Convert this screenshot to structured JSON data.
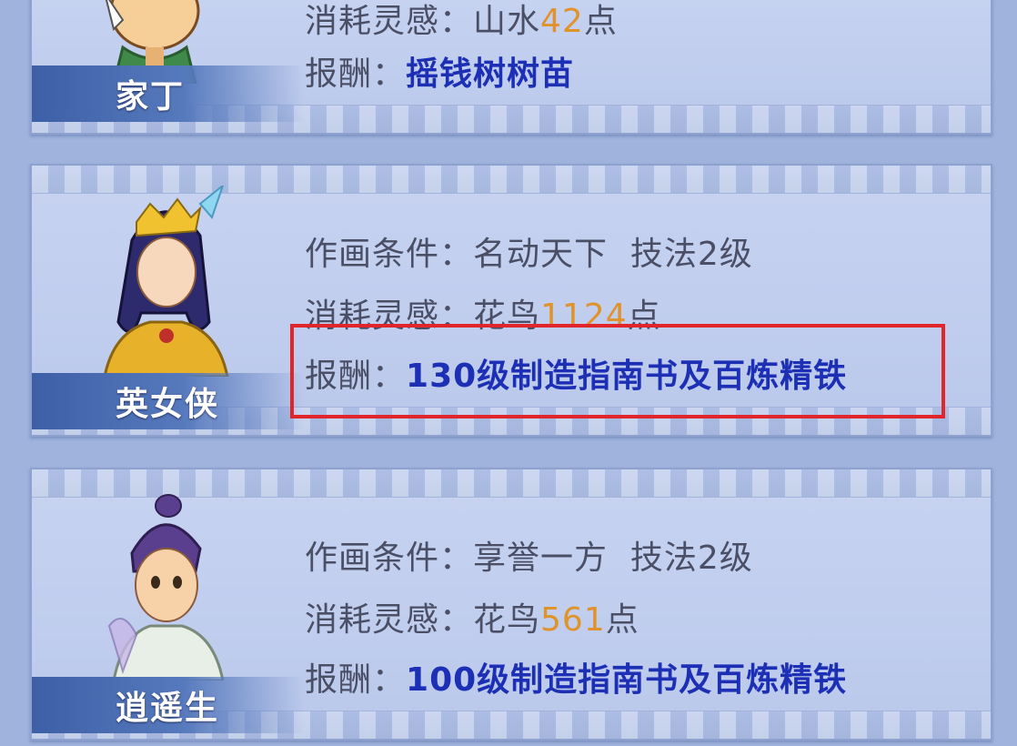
{
  "cards": [
    {
      "name": "家丁",
      "cost_label": "消耗灵感：",
      "cost_type": "山水",
      "cost_value": "42",
      "cost_unit": "点",
      "reward_label": "报酬：",
      "reward": "摇钱树树苗"
    },
    {
      "name": "英女侠",
      "cond_label": "作画条件：",
      "cond_value": "名动天下  技法2级",
      "cost_label": "消耗灵感：",
      "cost_type": "花鸟",
      "cost_value": "1124",
      "cost_unit": "点",
      "reward_label": "报酬：",
      "reward": "130级制造指南书及百炼精铁"
    },
    {
      "name": "逍遥生",
      "cond_label": "作画条件：",
      "cond_value": "享誉一方  技法2级",
      "cost_label": "消耗灵感：",
      "cost_type": "花鸟",
      "cost_value": "561",
      "cost_unit": "点",
      "reward_label": "报酬：",
      "reward": "100级制造指南书及百炼精铁"
    }
  ],
  "colors": {
    "background": "#9fb3dd",
    "reward_text": "#1c2fb5",
    "number_text": "#e0932a",
    "highlight_border": "#e0262b"
  }
}
